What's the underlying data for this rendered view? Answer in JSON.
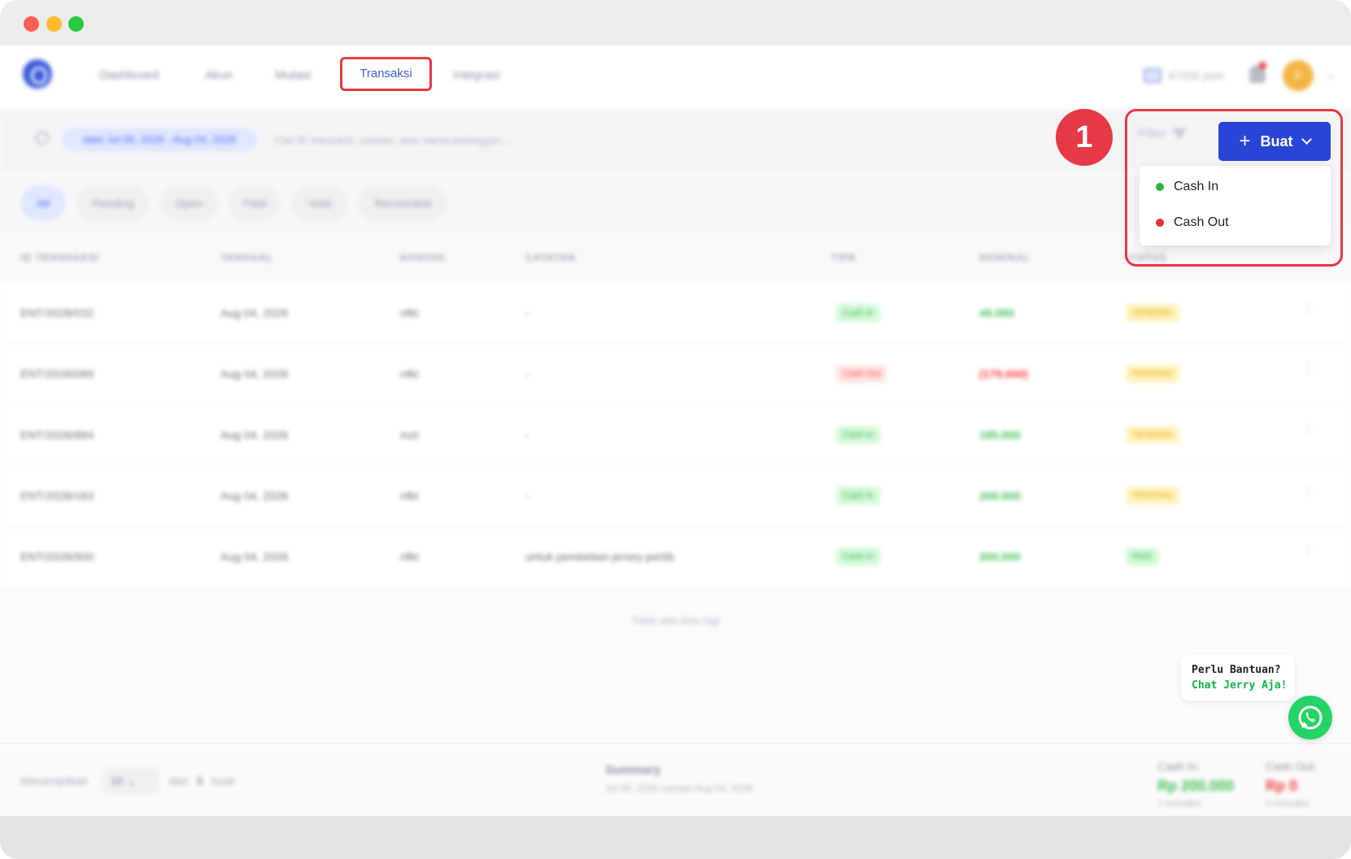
{
  "nav": {
    "items": [
      "Dashboard",
      "Akun",
      "Mutasi"
    ],
    "active": "Transaksi",
    "after_active": "Integrasi",
    "points": "47200 poin",
    "avatar_initial": "F"
  },
  "search": {
    "date_chip": "date Jul 06, 2026 - Aug 04, 2026",
    "placeholder": "Cari ID transaksi, catatan, atau nama pelanggan..."
  },
  "status_tabs": [
    "All",
    "Pending",
    "Open",
    "Paid",
    "Void",
    "Reconciled"
  ],
  "table": {
    "headers": [
      "ID TRANSAKSI",
      "TANGGAL",
      "KONTAK",
      "CATATAN",
      "TIPE",
      "NOMINAL",
      "STATUS"
    ],
    "rows": [
      {
        "id": "ENT/2026/032",
        "date": "Aug 04, 2026",
        "contact": "nfkt",
        "note": "-",
        "type": "Cash In",
        "amount": "49.000",
        "status": "PENDING"
      },
      {
        "id": "ENT/2026/089",
        "date": "Aug 04, 2026",
        "contact": "nfkt",
        "note": "-",
        "type": "Cash Out",
        "amount": "(179.000)",
        "status": "PENDING"
      },
      {
        "id": "ENT/2026/884",
        "date": "Aug 04, 2026",
        "contact": "mzt",
        "note": "-",
        "type": "Cash In",
        "amount": "195.000",
        "status": "PENDING"
      },
      {
        "id": "ENT/2026/163",
        "date": "Aug 04, 2026",
        "contact": "nfkt",
        "note": "-",
        "type": "Cash In",
        "amount": "200.000",
        "status": "PENDING"
      },
      {
        "id": "ENT/2026/900",
        "date": "Aug 04, 2026",
        "contact": "nfkt",
        "note": "untuk pembelian jersey pertib",
        "type": "Cash In",
        "amount": "200.000",
        "status": "PAID"
      }
    ],
    "empty_note": "Tidak ada data lagi"
  },
  "footer": {
    "showing_label": "Menampilkan",
    "per_page": "10",
    "of_label": "dari",
    "total": "5",
    "result_label": "hasil",
    "summary_title": "Summary",
    "summary_range": "Jul 06, 2026 sampai Aug 04, 2026",
    "cash_in_label": "Cash In:",
    "cash_in_value": "Rp 200.000",
    "cash_in_count": "1 transaksi",
    "cash_out_label": "Cash Out:",
    "cash_out_value": "Rp 0",
    "cash_out_count": "0 transaksi"
  },
  "callout_number": "1",
  "actions": {
    "filter_label": "Filter",
    "buat_label": "Buat",
    "dropdown": [
      {
        "label": "Cash In",
        "color": "#2fb344"
      },
      {
        "label": "Cash Out",
        "color": "#e03131"
      }
    ]
  },
  "help": {
    "line1": "Perlu Bantuan?",
    "line2": "Chat Jerry Aja!"
  },
  "colors": {
    "accent": "#2845d6",
    "highlight": "#e53945"
  }
}
